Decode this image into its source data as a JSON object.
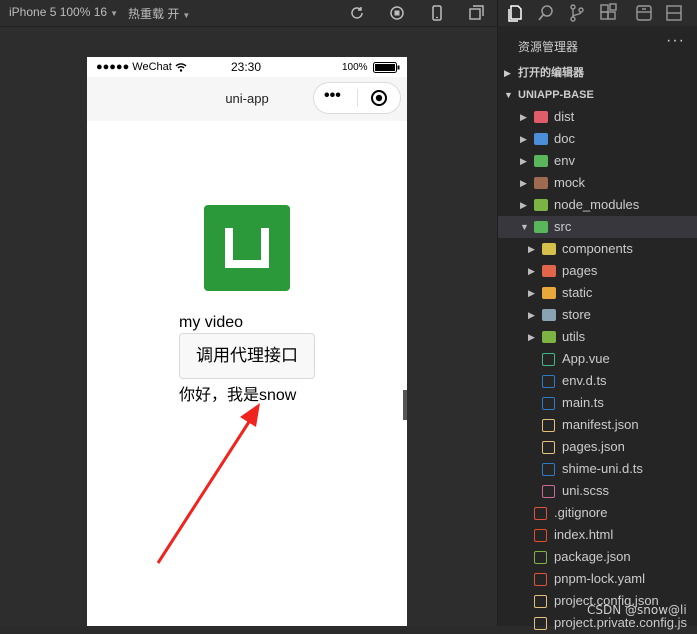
{
  "toolbar": {
    "device": "iPhone 5 100% 16",
    "hot_reload": "热重载 开"
  },
  "phone": {
    "status": {
      "signal": "●●●●● WeChat",
      "time": "23:30",
      "battery": "100%"
    },
    "nav_title": "uni-app",
    "capsule": {
      "more": "•••"
    },
    "content": {
      "video_text": "my video",
      "proxy_button": "调用代理接口",
      "hello_text": "你好，我是snow"
    }
  },
  "explorer": {
    "title": "资源管理器",
    "more": "···",
    "sections": [
      {
        "label": "打开的编辑器",
        "expanded": false
      },
      {
        "label": "UNIAPP-BASE",
        "expanded": true
      }
    ],
    "tree": [
      {
        "label": "dist",
        "icon": "folder-icon",
        "color": "#e05c6a"
      },
      {
        "label": "doc",
        "icon": "folder-icon",
        "color": "#4a8fd8"
      },
      {
        "label": "env",
        "icon": "folder-icon",
        "color": "#5ab65a"
      },
      {
        "label": "mock",
        "icon": "folder-icon",
        "color": "#a06a50"
      },
      {
        "label": "node_modules",
        "icon": "folder-icon",
        "color": "#7cb342"
      },
      {
        "label": "src",
        "icon": "folder-open-icon",
        "color": "#5ab65a"
      },
      {
        "label": "components",
        "icon": "folder-icon",
        "color": "#d4c04a"
      },
      {
        "label": "pages",
        "icon": "folder-icon",
        "color": "#e0654a"
      },
      {
        "label": "static",
        "icon": "folder-icon",
        "color": "#e8a93a"
      },
      {
        "label": "store",
        "icon": "folder-icon",
        "color": "#8aa3b3"
      },
      {
        "label": "utils",
        "icon": "folder-icon",
        "color": "#7cb342"
      },
      {
        "label": "App.vue",
        "icon": "vue-icon",
        "color": "#41b883"
      },
      {
        "label": "env.d.ts",
        "icon": "ts-icon",
        "color": "#3178c6"
      },
      {
        "label": "main.ts",
        "icon": "ts-icon",
        "color": "#3178c6"
      },
      {
        "label": "manifest.json",
        "icon": "json-icon",
        "color": "#e5c07b"
      },
      {
        "label": "pages.json",
        "icon": "json-icon",
        "color": "#e5c07b"
      },
      {
        "label": "shime-uni.d.ts",
        "icon": "ts-icon",
        "color": "#3178c6"
      },
      {
        "label": "uni.scss",
        "icon": "sass-icon",
        "color": "#cd6799"
      },
      {
        "label": ".gitignore",
        "icon": "git-icon",
        "color": "#e0533a"
      },
      {
        "label": "index.html",
        "icon": "html-icon",
        "color": "#e34c26"
      },
      {
        "label": "package.json",
        "icon": "node-icon",
        "color": "#7cb342"
      },
      {
        "label": "pnpm-lock.yaml",
        "icon": "yaml-icon",
        "color": "#e0533a"
      },
      {
        "label": "project.config.json",
        "icon": "json-icon",
        "color": "#e5c07b"
      },
      {
        "label": "project.private.config.js",
        "icon": "json-icon",
        "color": "#e5c07b"
      }
    ],
    "watermark": "CSDN @snow@li"
  },
  "annotation": {
    "arrow_color": "#f0231e"
  }
}
